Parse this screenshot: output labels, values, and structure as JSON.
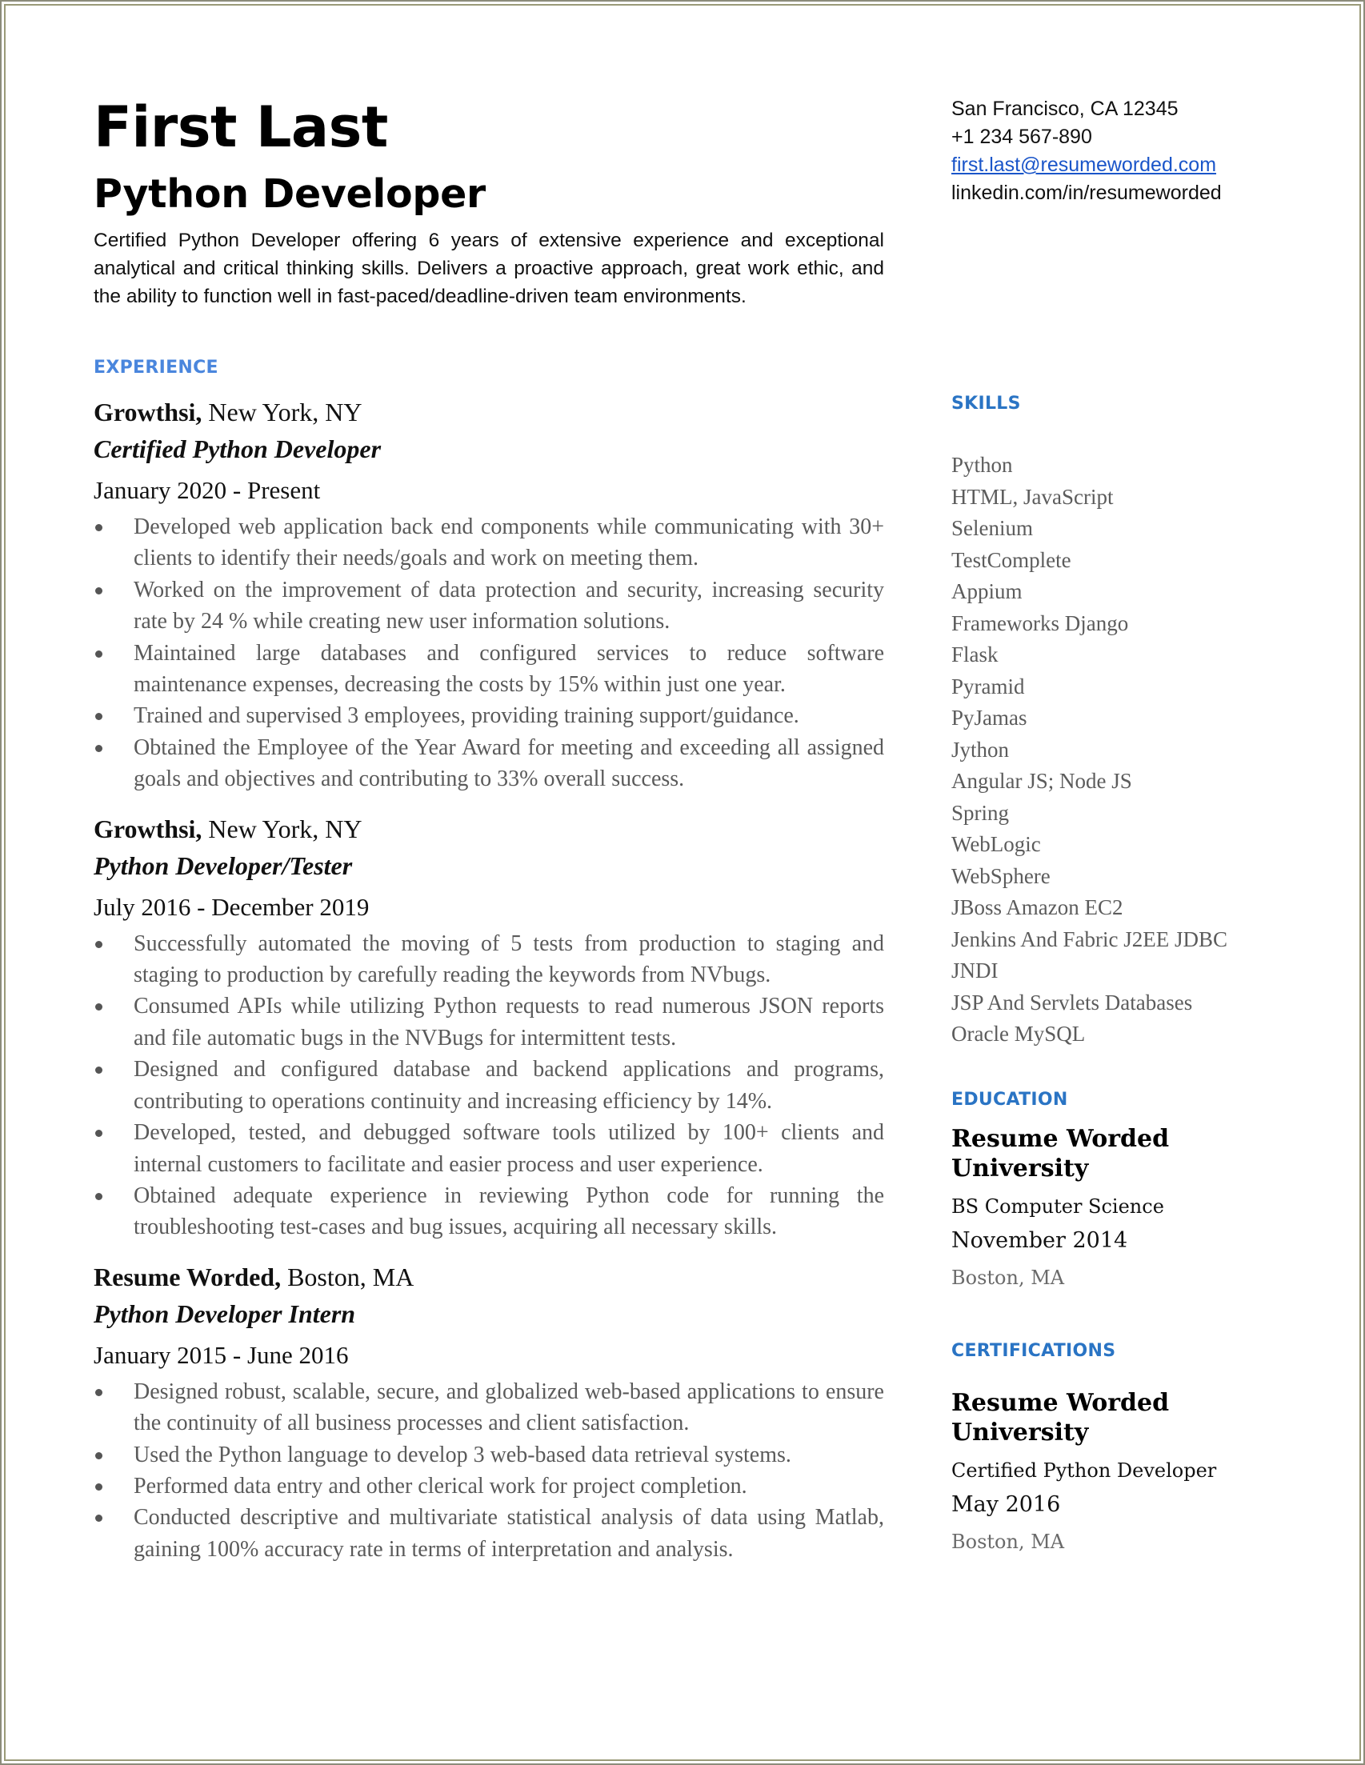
{
  "header": {
    "name": "First Last",
    "title": "Python Developer",
    "summary": "Certified Python Developer offering 6 years of extensive experience and exceptional analytical and critical thinking skills. Delivers a proactive approach, great work ethic, and the ability to function well in fast-paced/deadline-driven team environments."
  },
  "contact": {
    "location": "San Francisco, CA 12345",
    "phone": "+1 234 567-890",
    "email": "first.last@resumeworded.com",
    "linkedin": "linkedin.com/in/resumeworded"
  },
  "colors": {
    "experience_heading": "#4a86dd",
    "right_headings": "#2a74c4",
    "link": "#1a55c9",
    "bullet_text": "#5a5a5a"
  },
  "experience": {
    "heading": "EXPERIENCE",
    "jobs": [
      {
        "company": "Growthsi,",
        "location": " New York, NY",
        "role": "Certified Python Developer",
        "dates": "January 2020 - Present",
        "bullets": [
          "Developed web application back end components while communicating with 30+ clients to identify their needs/goals and work on meeting them.",
          "Worked on the improvement of data protection and security, increasing security rate by 24 %  while creating new user information solutions.",
          "Maintained large databases and configured services to reduce software maintenance expenses, decreasing the costs by 15% within just one year.",
          "Trained and supervised 3 employees, providing training support/guidance.",
          "Obtained the Employee of the Year Award for meeting and exceeding all assigned goals and objectives and contributing to 33% overall success."
        ]
      },
      {
        "company": "Growthsi,",
        "location": " New York, NY",
        "role": "Python Developer/Tester",
        "dates": "July 2016 - December 2019",
        "bullets": [
          "Successfully automated the moving of 5 tests from production to staging and staging to production by carefully reading the keywords from NVbugs.",
          "Consumed APIs while utilizing Python requests to read numerous JSON reports and file automatic bugs in the NVBugs for intermittent tests.",
          "Designed and configured database and backend applications and programs, contributing to operations continuity and increasing efficiency by 14%.",
          "Developed, tested, and debugged software tools utilized by 100+ clients and internal customers to facilitate and easier process and user experience.",
          "Obtained adequate experience in reviewing Python code for running the troubleshooting test-cases and bug issues, acquiring all necessary skills."
        ]
      },
      {
        "company": "Resume Worded,",
        "location": " Boston, MA",
        "role": "Python Developer Intern",
        "dates": "January 2015 - June 2016",
        "bullets": [
          "Designed robust, scalable, secure, and globalized web-based applications to ensure the continuity of all business processes and client satisfaction.",
          "Used the Python language to develop 3 web-based data retrieval systems.",
          "Performed data entry and other clerical work for project completion.",
          "Conducted descriptive and multivariate statistical analysis of data using Matlab, gaining 100% accuracy rate in terms of interpretation and analysis."
        ]
      }
    ]
  },
  "skills": {
    "heading": "SKILLS",
    "items": [
      "Python",
      "HTML, JavaScript",
      "Selenium",
      "TestComplete",
      "Appium",
      "Frameworks Django",
      "Flask",
      "Pyramid",
      "PyJamas",
      "Jython",
      "Angular JS; Node JS",
      "Spring",
      "WebLogic",
      "WebSphere",
      "JBoss Amazon EC2",
      "Jenkins And Fabric J2EE JDBC",
      "JNDI",
      "JSP And Servlets Databases",
      "Oracle MySQL"
    ]
  },
  "education": {
    "heading": "EDUCATION",
    "school": "Resume Worded University",
    "degree": "BS Computer Science",
    "date": "November 2014",
    "location": "Boston, MA"
  },
  "certifications": {
    "heading": "CERTIFICATIONS",
    "issuer": "Resume Worded University",
    "name": "Certified Python Developer",
    "date": "May 2016",
    "location": "Boston, MA"
  }
}
